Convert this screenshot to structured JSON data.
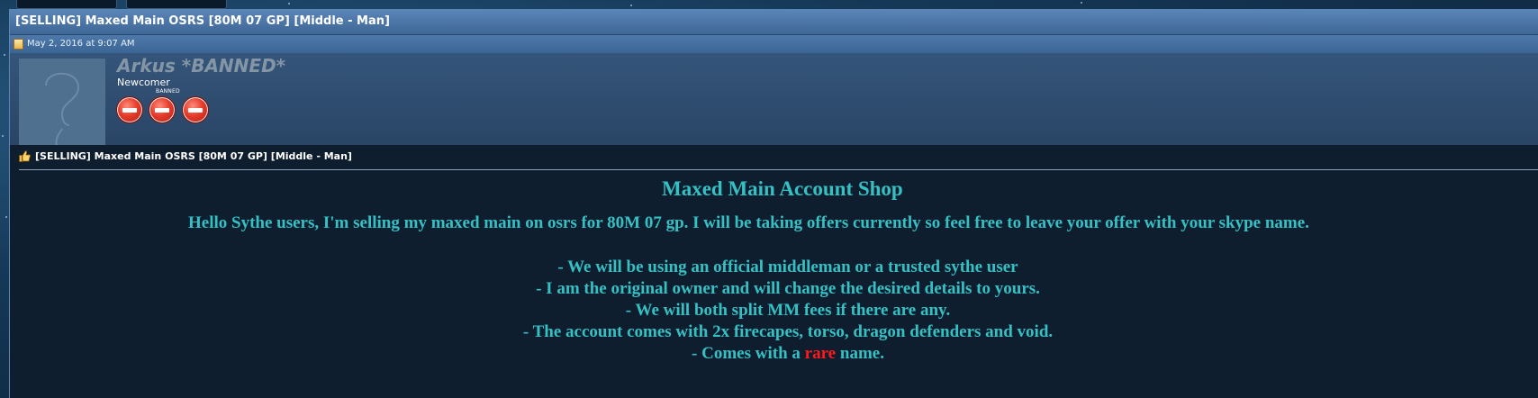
{
  "thread": {
    "title": "[SELLING] Maxed Main OSRS [80M 07 GP] [Middle - Man]",
    "date": "May 2, 2016 at 9:07 AM"
  },
  "user": {
    "name": "Arkus *BANNED*",
    "title": "Newcomer",
    "badge_label": "BANNED",
    "badge_icons": [
      "no-entry-icon",
      "no-entry-icon",
      "no-entry-icon"
    ]
  },
  "post": {
    "title": "[SELLING] Maxed Main OSRS [80M 07 GP] [Middle - Man]",
    "heading": "Maxed Main Account Shop",
    "intro": "Hello Sythe users, I'm selling my maxed main on osrs for 80M 07 gp. I will be taking offers currently so feel free to leave your offer with your skype name.",
    "lines": [
      "- We will be using an official middleman or a trusted sythe user",
      "- I am the original owner and will change the desired details to yours.",
      "- We will both split MM fees if there are any.",
      "- The account comes with 2x firecapes, torso, dragon defenders and void."
    ],
    "last_line_prefix": "- Comes with a ",
    "last_line_highlight": "rare",
    "last_line_suffix": " name."
  },
  "colors": {
    "text_accent": "#35c1c4",
    "highlight": "#ff1a1a",
    "title_bar": "#4d79aa"
  }
}
